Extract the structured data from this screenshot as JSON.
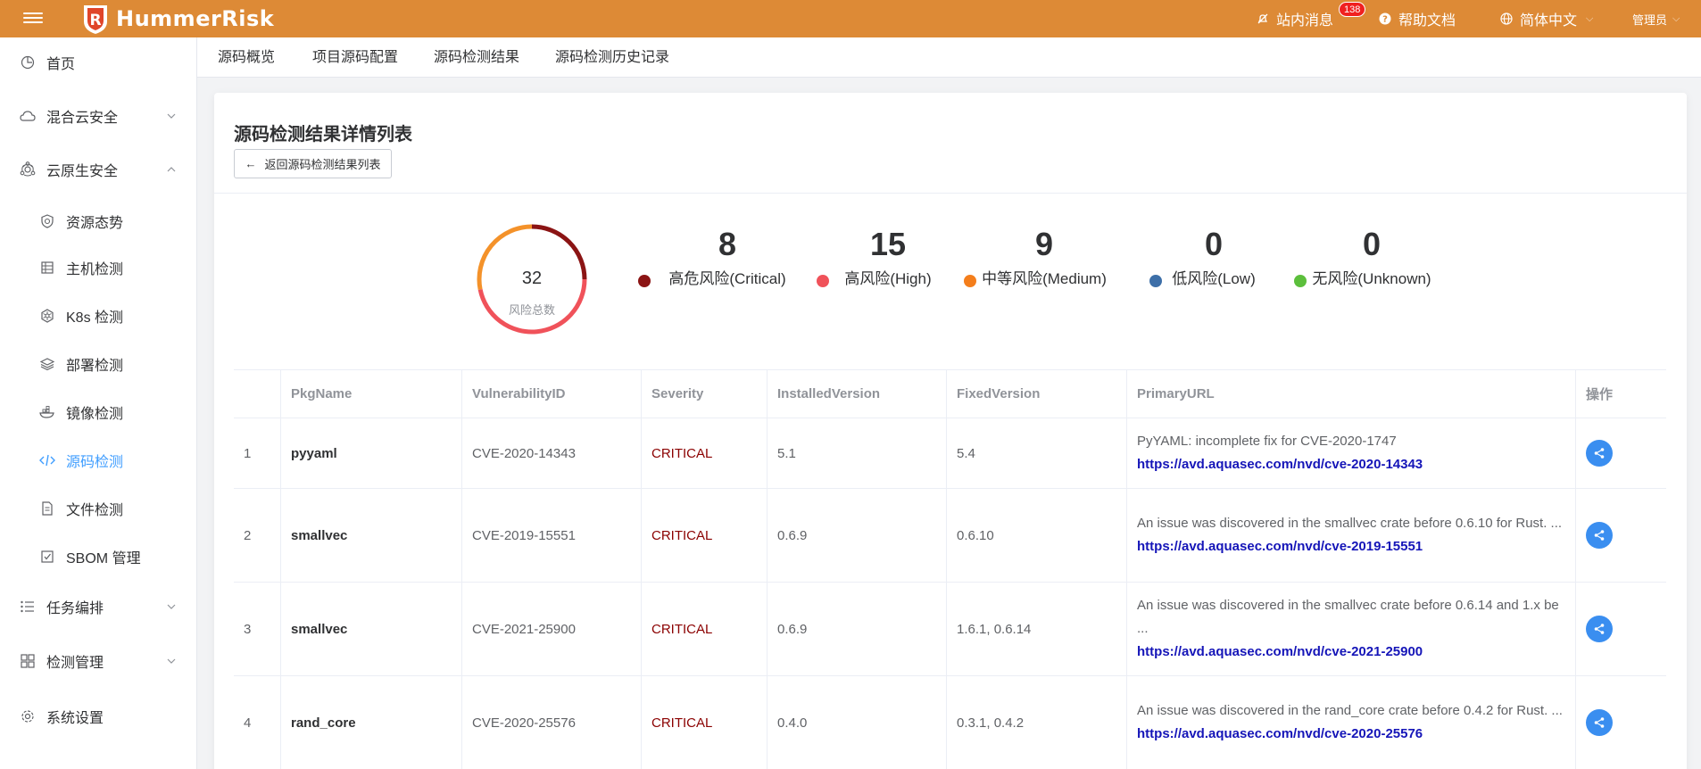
{
  "app": {
    "brand": "HummerRisk"
  },
  "topbar": {
    "messages_label": "站内消息",
    "messages_count": "138",
    "help_label": "帮助文档",
    "language_label": "简体中文",
    "user_label": "管理员"
  },
  "sidebar": {
    "items": [
      {
        "label": "首页",
        "icon": "home-icon"
      },
      {
        "label": "混合云安全",
        "icon": "cloud-icon",
        "expandable": true,
        "expanded": false
      },
      {
        "label": "云原生安全",
        "icon": "cloud-native-icon",
        "expandable": true,
        "expanded": true
      },
      {
        "label": "任务编排",
        "icon": "list-icon",
        "expandable": true,
        "expanded": false
      },
      {
        "label": "检测管理",
        "icon": "grid-icon",
        "expandable": true,
        "expanded": false
      },
      {
        "label": "系统设置",
        "icon": "gear-icon"
      }
    ],
    "sub_items": [
      {
        "label": "资源态势",
        "icon": "shield-icon"
      },
      {
        "label": "主机检测",
        "icon": "server-icon"
      },
      {
        "label": "K8s 检测",
        "icon": "k8s-icon"
      },
      {
        "label": "部署检测",
        "icon": "layers-icon"
      },
      {
        "label": "镜像检测",
        "icon": "container-icon"
      },
      {
        "label": "源码检测",
        "icon": "code-icon",
        "active": true
      },
      {
        "label": "文件检测",
        "icon": "file-icon"
      },
      {
        "label": "SBOM 管理",
        "icon": "checkbox-icon"
      }
    ]
  },
  "tabs": [
    "源码概览",
    "项目源码配置",
    "源码检测结果",
    "源码检测历史记录"
  ],
  "page": {
    "title": "源码检测结果详情列表",
    "back_label": "返回源码检测结果列表"
  },
  "summary": {
    "total": "32",
    "total_label": "风险总数",
    "stats": [
      {
        "value": "8",
        "label": "高危风险(Critical)",
        "color": "#8b1414"
      },
      {
        "value": "15",
        "label": "高风险(High)",
        "color": "#f0525a"
      },
      {
        "value": "9",
        "label": "中等风险(Medium)",
        "color": "#f47e1c"
      },
      {
        "value": "0",
        "label": "低风险(Low)",
        "color": "#3d6fa8"
      },
      {
        "value": "0",
        "label": "无风险(Unknown)",
        "color": "#5cbf3c"
      }
    ],
    "colors": {
      "critical": "#8b1414",
      "high": "#f0525a",
      "medium": "#f4922a"
    }
  },
  "table": {
    "headers": [
      "",
      "PkgName",
      "VulnerabilityID",
      "Severity",
      "InstalledVersion",
      "FixedVersion",
      "PrimaryURL",
      "操作"
    ],
    "rows": [
      {
        "index": "1",
        "pkg": "pyyaml",
        "vuln_id": "CVE-2020-14343",
        "severity": "CRITICAL",
        "installed": "5.1",
        "fixed": "5.4",
        "desc": "PyYAML: incomplete fix for CVE-2020-1747",
        "url": "https://avd.aquasec.com/nvd/cve-2020-14343"
      },
      {
        "index": "2",
        "pkg": "smallvec",
        "vuln_id": "CVE-2019-15551",
        "severity": "CRITICAL",
        "installed": "0.6.9",
        "fixed": "0.6.10",
        "desc": "An issue was discovered in the smallvec crate before 0.6.10 for Rust. ...",
        "url": "https://avd.aquasec.com/nvd/cve-2019-15551"
      },
      {
        "index": "3",
        "pkg": "smallvec",
        "vuln_id": "CVE-2021-25900",
        "severity": "CRITICAL",
        "installed": "0.6.9",
        "fixed": "1.6.1, 0.6.14",
        "desc": "An issue was discovered in the smallvec crate before 0.6.14 and 1.x be ...",
        "url": "https://avd.aquasec.com/nvd/cve-2021-25900"
      },
      {
        "index": "4",
        "pkg": "rand_core",
        "vuln_id": "CVE-2020-25576",
        "severity": "CRITICAL",
        "installed": "0.4.0",
        "fixed": "0.3.1, 0.4.2",
        "desc": "An issue was discovered in the rand_core crate before 0.4.2 for Rust. ...",
        "url": "https://avd.aquasec.com/nvd/cve-2020-25576"
      }
    ]
  }
}
